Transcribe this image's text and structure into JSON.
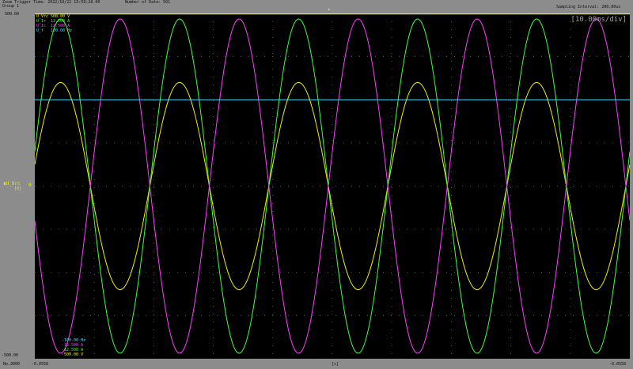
{
  "header": {
    "trigger_time": "Zoom Trigger Time: 2022/10/22 15:59:28.00",
    "group": "Group 1",
    "data_count": "Number of Data: 501",
    "sampling": "Sampling Interval: 200.00us"
  },
  "time_div": "[10.00ms/div]",
  "y_top": "500.00",
  "y_bottom": "-500.00",
  "left_channel": {
    "name": "U_Vrc",
    "unit": "[V]",
    "zero": "0"
  },
  "legend_top": [
    {
      "name": "U_Vrc",
      "value": "500.00 V",
      "color": "#f0f000"
    },
    {
      "name": "U_Ir",
      "value": "12.500 A",
      "color": "#40ff40"
    },
    {
      "name": "U_Ic",
      "value": "12.500 A",
      "color": "#ff40ff"
    },
    {
      "name": "U_f",
      "value": "100.00 Hz",
      "color": "#40e0ff"
    }
  ],
  "legend_bottom": [
    {
      "value": "-100.00 Hz",
      "color": "#40e0ff"
    },
    {
      "value": "-12.500 A",
      "color": "#ff40ff"
    },
    {
      "value": "-12.500 A",
      "color": "#40ff40"
    },
    {
      "value": "-500.00 V",
      "color": "#f0f000"
    }
  ],
  "footer": {
    "no": "No.3000",
    "start": "-0.0558",
    "cursor": "[s]",
    "end": "-0.0558"
  },
  "chart_data": {
    "type": "line",
    "x_unit": "s",
    "x_range": [
      0,
      0.1
    ],
    "time_per_div": 0.01,
    "divisions": {
      "x": 10,
      "y": 8
    },
    "series": [
      {
        "name": "U_Vrc",
        "color": "#f0f000",
        "kind": "sine",
        "frequency_hz": 50,
        "amplitude": 300,
        "phase_deg": 12,
        "scale_min": -500,
        "scale_max": 500
      },
      {
        "name": "U_Ir",
        "color": "#40ff40",
        "kind": "sine",
        "frequency_hz": 50,
        "amplitude": 12.1,
        "phase_deg": 12,
        "scale_min": -12.5,
        "scale_max": 12.5
      },
      {
        "name": "U_Ic",
        "color": "#ff40ff",
        "kind": "sine",
        "frequency_hz": 50,
        "amplitude": 12.1,
        "phase_deg": 192,
        "scale_min": -12.5,
        "scale_max": 12.5
      },
      {
        "name": "U_f",
        "color": "#40e0ff",
        "kind": "constant",
        "value": 50,
        "scale_min": -100,
        "scale_max": 100
      }
    ]
  }
}
